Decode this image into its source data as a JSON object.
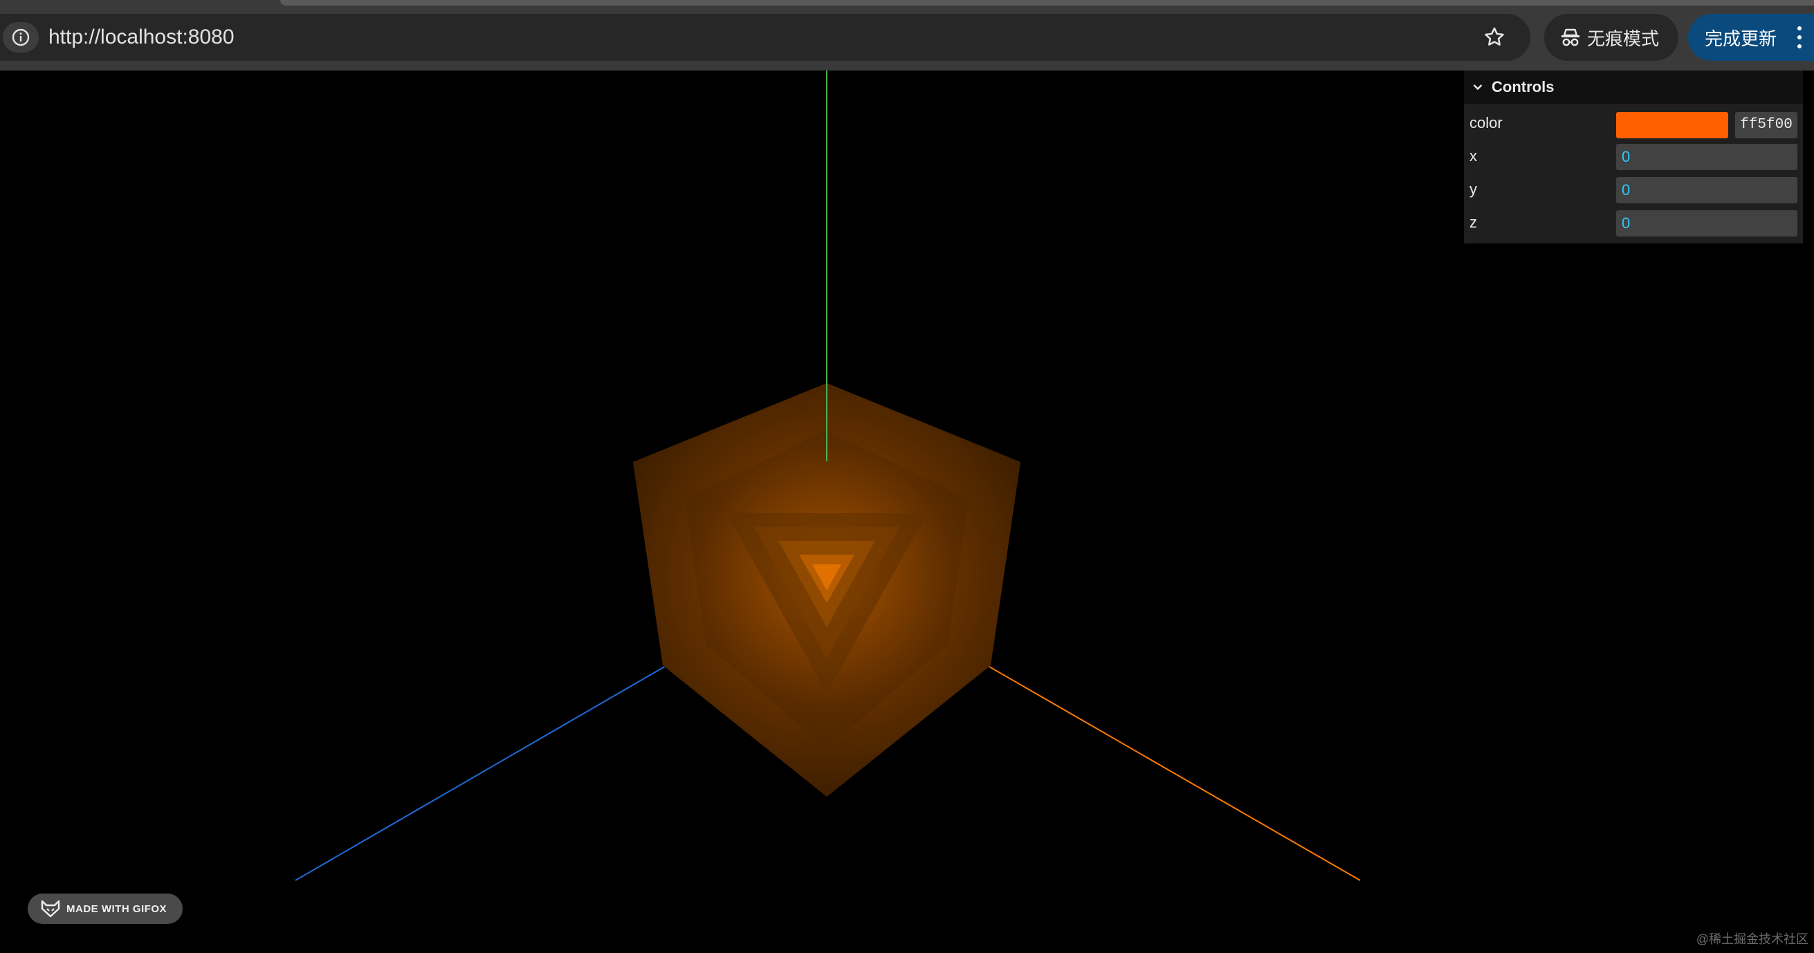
{
  "browser": {
    "url": "http://localhost:8080",
    "incognito_label": "无痕模式",
    "update_label": "完成更新"
  },
  "controls": {
    "title": "Controls",
    "color": {
      "label": "color",
      "hex": "ff5f00",
      "value": "#ff5f00"
    },
    "x": {
      "label": "x",
      "value": "0"
    },
    "y": {
      "label": "y",
      "value": "0"
    },
    "z": {
      "label": "z",
      "value": "0"
    }
  },
  "scene": {
    "axis_colors": {
      "x": "#ff7a00",
      "y": "#4caf50",
      "z": "#1e6bd8"
    },
    "cube_color": "#ff5f00"
  },
  "gifox": {
    "label": "MADE WITH GIFOX"
  },
  "watermark": "@稀土掘金技术社区"
}
